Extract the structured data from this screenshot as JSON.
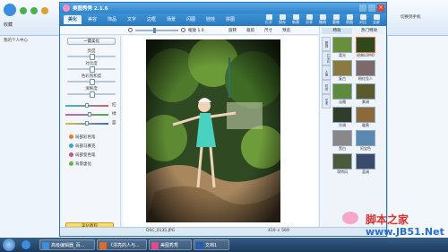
{
  "app": {
    "title": "美图秀秀 2.1.6",
    "nav_tabs": [
      "美化",
      "美容",
      "饰品",
      "文字",
      "边框",
      "场景",
      "闪图",
      "娃娃",
      "拼图"
    ],
    "active_tab": "美化",
    "tools": [
      "打开",
      "保存",
      "新建",
      "分享",
      "撤销",
      "重做",
      "原图",
      "对比",
      "全屏"
    ],
    "left_panel": {
      "one_click": "一键美化",
      "sliders": [
        {
          "label": "亮度",
          "value": 0.5
        },
        {
          "label": "对比度",
          "value": 0.5
        },
        {
          "label": "色彩饱和度",
          "value": 0.5
        },
        {
          "label": "清晰度",
          "value": 0.5
        }
      ],
      "color_sliders": [
        {
          "label": "红",
          "value": 0.5
        },
        {
          "label": "绿",
          "value": 0.55
        },
        {
          "label": "蓝",
          "value": 0.5
        }
      ],
      "options": [
        "局部彩色笔",
        "局部马赛克",
        "局部变色笔",
        "背景虚化"
      ],
      "bottom_button": "美化教程"
    },
    "toolbar": {
      "zoom_label": "缩放",
      "zoom_value": "1.0",
      "rotate": "旋转",
      "crop": "裁剪",
      "size": "尺寸",
      "preview": "预览"
    },
    "right_panel": {
      "header_tabs": [
        "特效",
        "热门特效"
      ],
      "side_tabs": [
        "基础",
        "LOMO",
        "人像",
        "时尚",
        "艺术"
      ],
      "effects": [
        "柔光",
        "经典LOMO",
        "复古",
        "粉红佳人",
        "淡雅",
        "紫调",
        "冷调",
        "暖黄",
        "黑白",
        "阿宝色",
        "哥特风",
        "蓝调"
      ]
    },
    "status": {
      "filename": "DSC_0135.JPG",
      "dimensions": "419 × 569"
    }
  },
  "browser": {
    "sidebar_tabs": [
      "收藏",
      "我的个人中心"
    ],
    "right_menu": [
      "切换到手机"
    ]
  },
  "taskbar": {
    "items": [
      "高级编辑器_百...",
      "《漂亮的人与...",
      "美图秀秀",
      "文档1"
    ],
    "time": "Net"
  },
  "watermark": {
    "line1": "脚本之家",
    "line2": "www.JB51.Net"
  },
  "colors": {
    "accent": "#2f83c9",
    "nav": "#2a78bd",
    "taskbar": "#1c3a5c"
  }
}
